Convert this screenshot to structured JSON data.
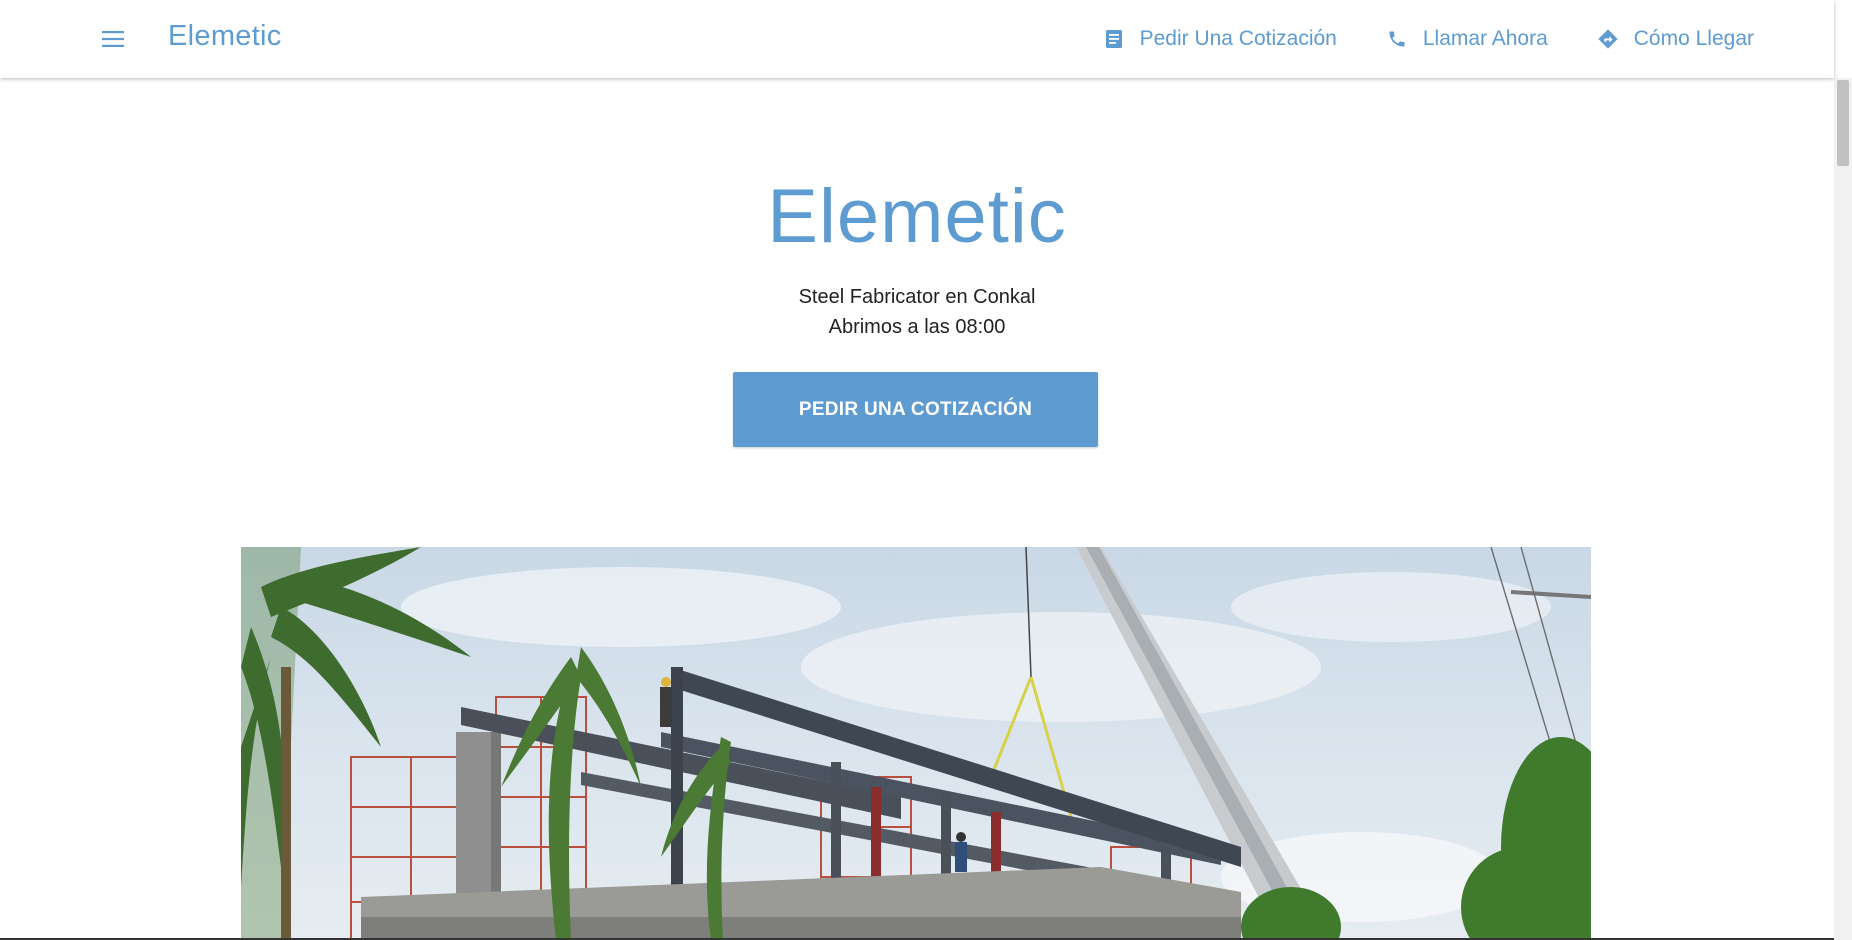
{
  "header": {
    "brand": "Elemetic",
    "menu_icon": "hamburger-menu-icon",
    "nav": [
      {
        "label": "Pedir Una Cotización",
        "icon": "document-icon"
      },
      {
        "label": "Llamar Ahora",
        "icon": "phone-icon"
      },
      {
        "label": "Cómo Llegar",
        "icon": "directions-icon"
      }
    ]
  },
  "hero": {
    "title": "Elemetic",
    "subtitle_line1": "Steel Fabricator en Conkal",
    "subtitle_line2": "Abrimos a las 08:00",
    "cta_label": "PEDIR UNA COTIZACIÓN"
  },
  "colors": {
    "accent": "#5e9bd0",
    "text": "#222222",
    "background": "#ffffff"
  }
}
